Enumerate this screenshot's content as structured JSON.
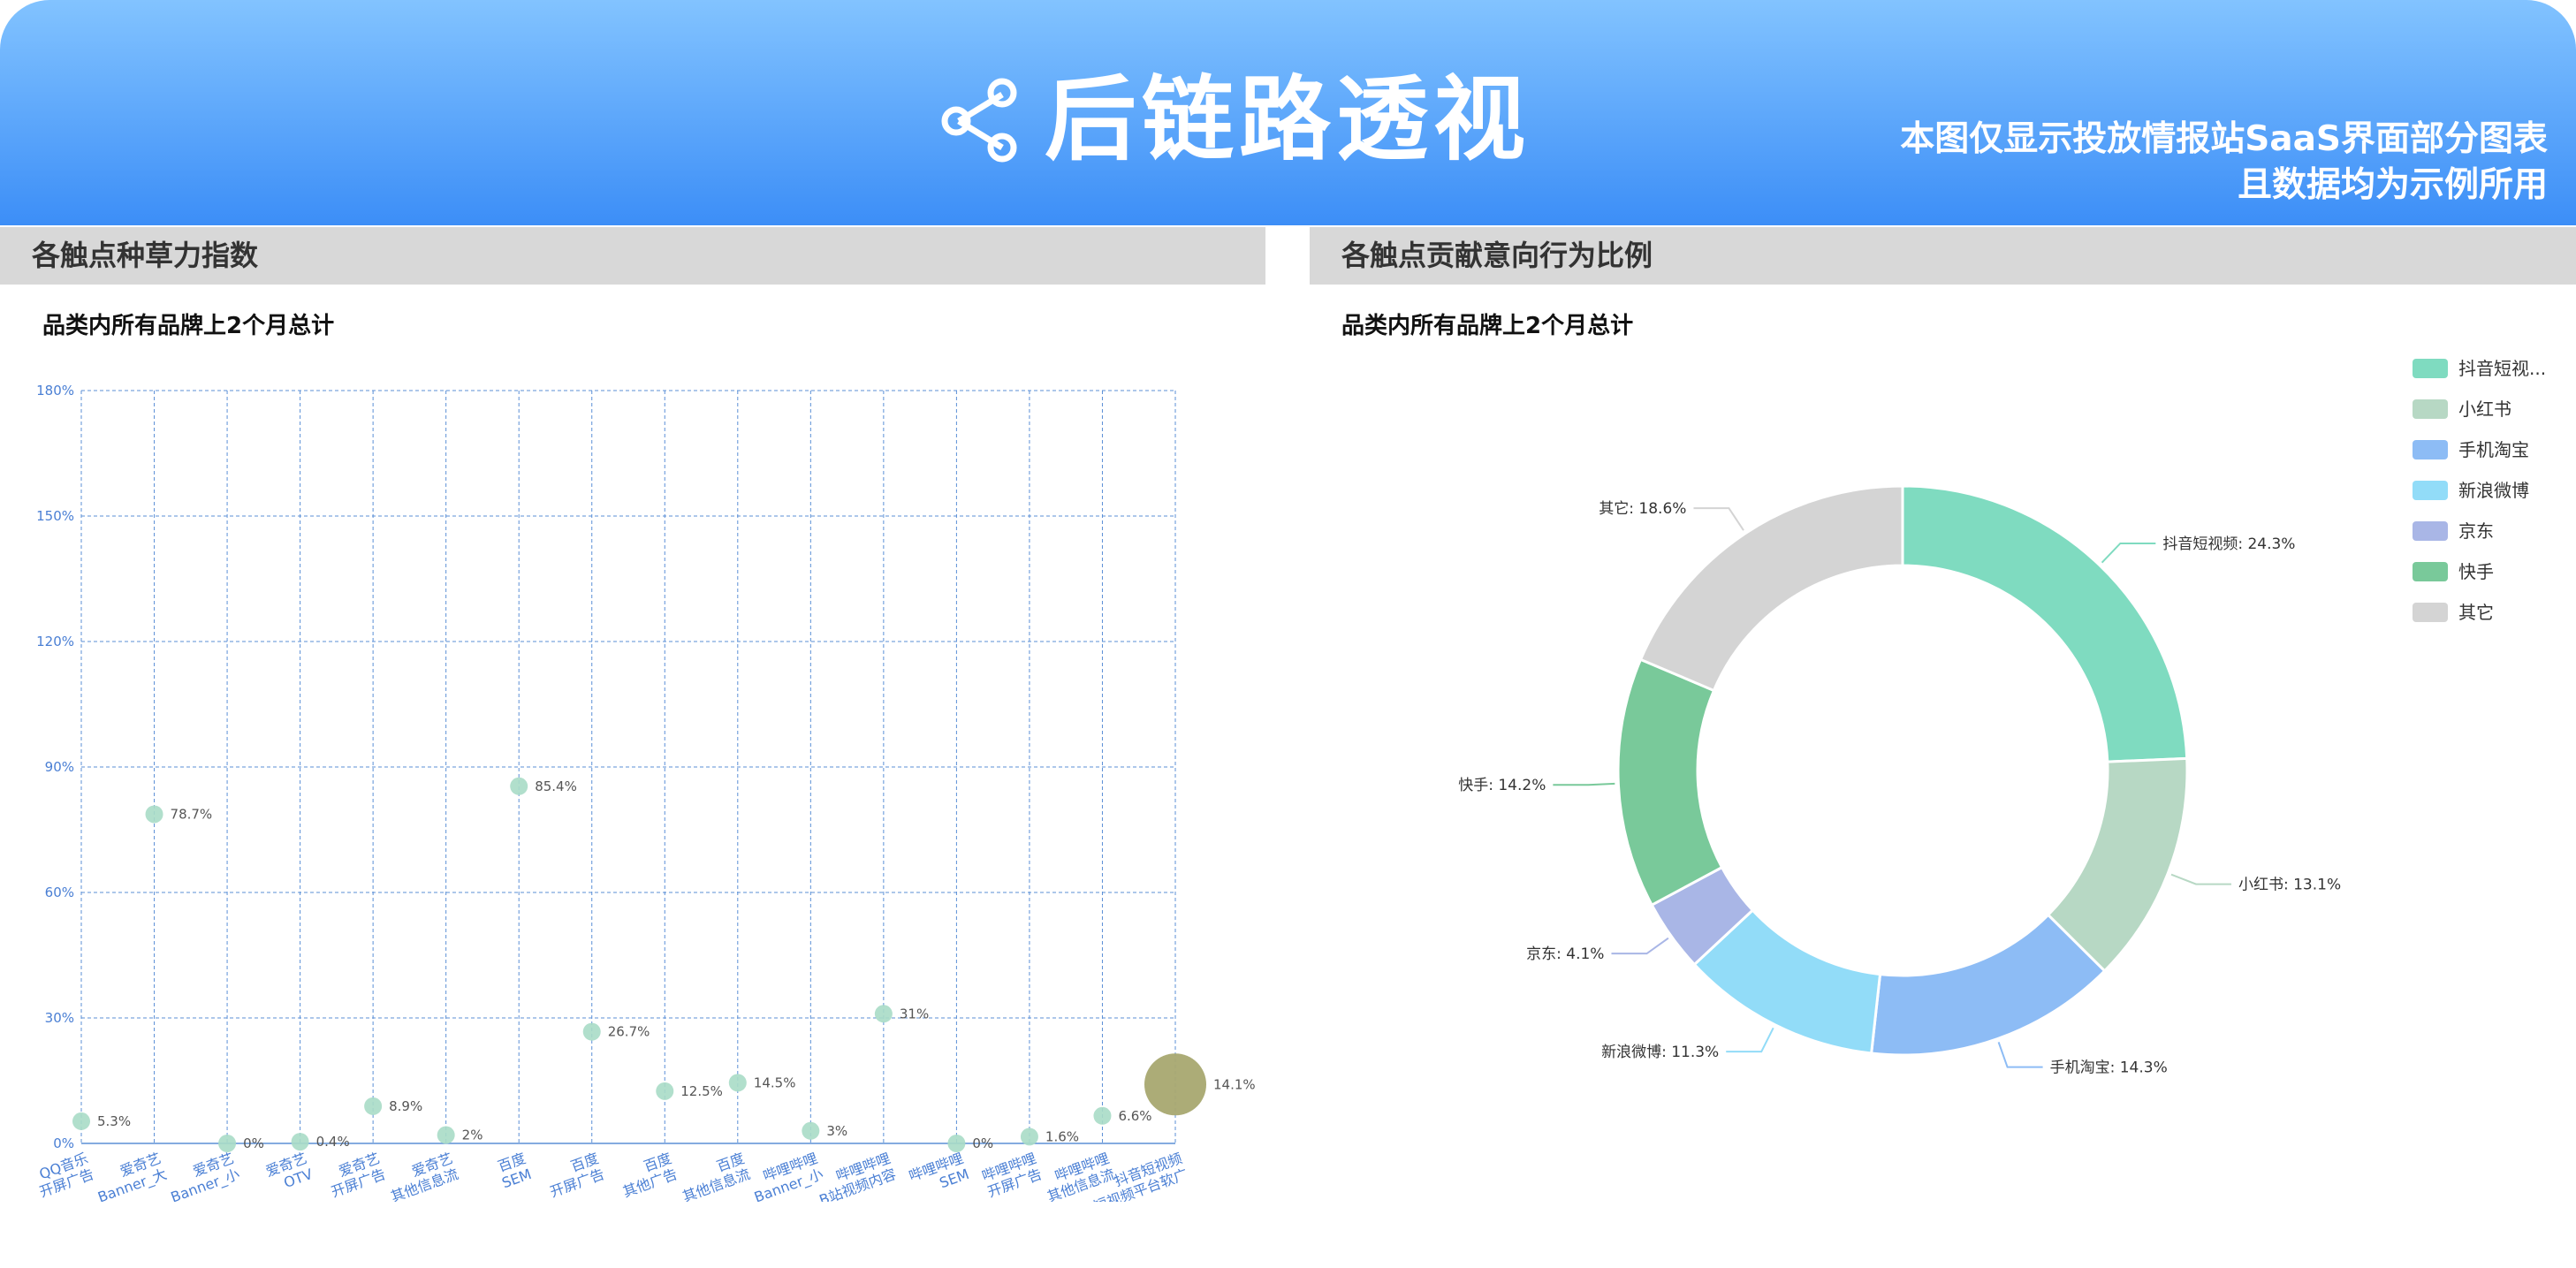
{
  "header": {
    "title": "后链路透视",
    "note_line1": "本图仅显示投放情报站SaaS界面部分图表",
    "note_line2": "且数据均为示例所用"
  },
  "left_panel": {
    "title": "各触点种草力指数",
    "subtitle": "品类内所有品牌上2个月总计"
  },
  "right_panel": {
    "title": "各触点贡献意向行为比例",
    "subtitle": "品类内所有品牌上2个月总计"
  },
  "colors": {
    "banner_top": "#82c3ff",
    "banner_bottom": "#3c8ef7",
    "grid": "#5b8fd6",
    "axis_text": "#4a7fd4",
    "bubble": "#a9dcc7",
    "bubble_highlight": "#a8a870"
  },
  "chart_data": [
    {
      "type": "scatter",
      "ylim": [
        0,
        180
      ],
      "y_ticks": [
        "0%",
        "30%",
        "60%",
        "90%",
        "120%",
        "150%",
        "180%"
      ],
      "categories": [
        "QQ音乐\n开屏广告",
        "爱奇艺\nBanner_大",
        "爱奇艺\nBanner_小",
        "爱奇艺\nOTV",
        "爱奇艺\n开屏广告",
        "爱奇艺\n其他信息流",
        "百度\nSEM",
        "百度\n开屏广告",
        "百度\n其他广告",
        "百度\n其他信息流",
        "哔哩哔哩\nBanner_小",
        "哔哩哔哩\nB站视频内容",
        "哔哩哔哩\nSEM",
        "哔哩哔哩\n开屏广告",
        "哔哩哔哩\n其他信息流",
        "抖音短视频\n短视频平台软广"
      ],
      "values": [
        5.3,
        78.7,
        0,
        0.4,
        8.9,
        2,
        85.4,
        26.7,
        12.5,
        14.5,
        3,
        31,
        0,
        1.6,
        6.6,
        14.1
      ],
      "point_labels": [
        "5.3%",
        "78.7%",
        "0%",
        "0.4%",
        "8.9%",
        "2%",
        "85.4%",
        "26.7%",
        "12.5%",
        "14.5%",
        "3%",
        "31%",
        "0%",
        "1.6%",
        "6.6%",
        "14.1%"
      ],
      "highlight_index": 15,
      "grid": true
    },
    {
      "type": "pie",
      "donut": true,
      "legend_position": "right-top",
      "legend_labels": [
        "抖音短视...",
        "小红书",
        "手机淘宝",
        "新浪微博",
        "京东",
        "快手",
        "其它"
      ],
      "slices": [
        {
          "name": "抖音短视频",
          "label": "抖音短视频: 24.3%",
          "value": 24.3,
          "color": "#7fdbc0"
        },
        {
          "name": "小红书",
          "label": "小红书: 13.1%",
          "value": 13.1,
          "color": "#b7d8c4"
        },
        {
          "name": "手机淘宝",
          "label": "手机淘宝: 14.3%",
          "value": 14.3,
          "color": "#8dbcf5"
        },
        {
          "name": "新浪微博",
          "label": "新浪微博: 11.3%",
          "value": 11.3,
          "color": "#92dcf8"
        },
        {
          "name": "京东",
          "label": "京东: 4.1%",
          "value": 4.1,
          "color": "#a9b6e6"
        },
        {
          "name": "快手",
          "label": "快手: 14.2%",
          "value": 14.2,
          "color": "#79c99a"
        },
        {
          "name": "其它",
          "label": "其它: 18.6%",
          "value": 18.6,
          "color": "#d4d4d4"
        }
      ]
    }
  ]
}
